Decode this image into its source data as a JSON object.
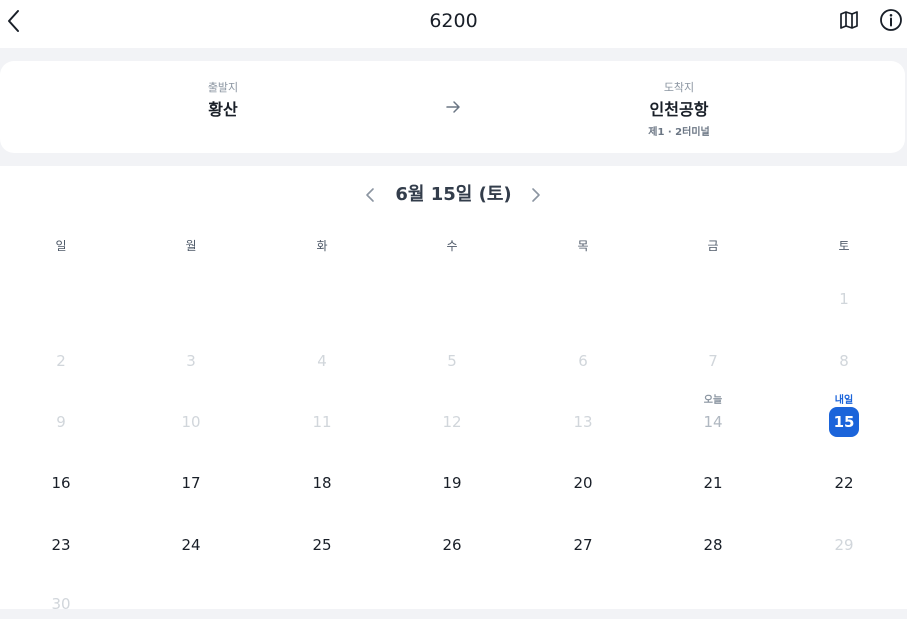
{
  "header": {
    "title": "6200",
    "back_icon": "chevron-left-icon",
    "map_icon": "map-icon",
    "info_icon": "info-circle-icon"
  },
  "route": {
    "departure_label": "출발지",
    "departure_name": "황산",
    "arrival_label": "도착지",
    "arrival_name": "인천공항",
    "arrival_sub": "제1 · 2터미널",
    "arrow_icon": "arrow-right-icon"
  },
  "calendar": {
    "month_label": "6월 15일 (토)",
    "weekdays": [
      "일",
      "월",
      "화",
      "수",
      "목",
      "금",
      "토"
    ],
    "today_tag": "오늘",
    "tomorrow_tag": "내일",
    "selected_day": "15",
    "accent_color": "#1b64da",
    "days": {
      "d1": "1",
      "d2": "2",
      "d3": "3",
      "d4": "4",
      "d5": "5",
      "d6": "6",
      "d7": "7",
      "d8": "8",
      "d9": "9",
      "d10": "10",
      "d11": "11",
      "d12": "12",
      "d13": "13",
      "d14": "14",
      "d16": "16",
      "d17": "17",
      "d18": "18",
      "d19": "19",
      "d20": "20",
      "d21": "21",
      "d22": "22",
      "d23": "23",
      "d24": "24",
      "d25": "25",
      "d26": "26",
      "d27": "27",
      "d28": "28",
      "d29": "29",
      "d30": "30"
    }
  }
}
